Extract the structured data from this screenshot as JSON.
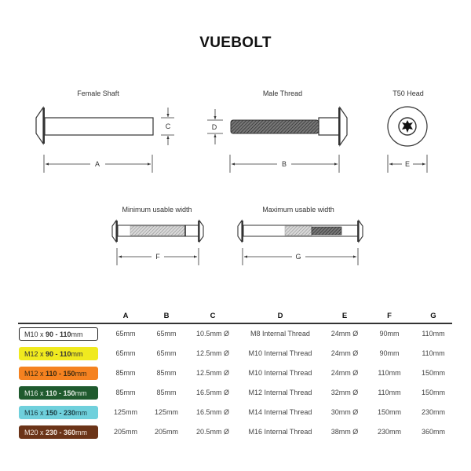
{
  "title": "VUEBOLT",
  "diagrams": {
    "female_shaft": {
      "label": "Female Shaft",
      "dims": [
        "A",
        "C"
      ]
    },
    "male_thread": {
      "label": "Male Thread",
      "dims": [
        "B",
        "D"
      ]
    },
    "head": {
      "label": "T50 Head",
      "dims": [
        "E"
      ]
    },
    "min_width": {
      "label": "Minimum usable width",
      "dims": [
        "F"
      ]
    },
    "max_width": {
      "label": "Maximum usable width",
      "dims": [
        "G"
      ]
    }
  },
  "table": {
    "columns": [
      "A",
      "B",
      "C",
      "D",
      "E",
      "F",
      "G"
    ],
    "rows": [
      {
        "size": "M10 x ",
        "range": "90 - 110",
        "unit": "mm",
        "bg": "#ffffff",
        "fg": "#333333",
        "border": "#222222",
        "values": [
          "65mm",
          "65mm",
          "10.5mm Ø",
          "M8 Internal Thread",
          "24mm Ø",
          "90mm",
          "110mm"
        ]
      },
      {
        "size": "M12 x ",
        "range": "90 - 110",
        "unit": "mm",
        "bg": "#f0ea1f",
        "fg": "#333333",
        "border": "#f0ea1f",
        "values": [
          "65mm",
          "65mm",
          "12.5mm Ø",
          "M10 Internal Thread",
          "24mm Ø",
          "90mm",
          "110mm"
        ]
      },
      {
        "size": "M12 x ",
        "range": "110 - 150",
        "unit": "mm",
        "bg": "#f58220",
        "fg": "#3a2a10",
        "border": "#f58220",
        "values": [
          "85mm",
          "85mm",
          "12.5mm Ø",
          "M10 Internal Thread",
          "24mm Ø",
          "110mm",
          "150mm"
        ]
      },
      {
        "size": "M16 x ",
        "range": "110 - 150",
        "unit": "mm",
        "bg": "#1f5a2e",
        "fg": "#e8f0e8",
        "border": "#1f5a2e",
        "values": [
          "85mm",
          "85mm",
          "16.5mm Ø",
          "M12 Internal Thread",
          "32mm Ø",
          "110mm",
          "150mm"
        ]
      },
      {
        "size": "M16 x ",
        "range": "150 - 230",
        "unit": "mm",
        "bg": "#6fd0dc",
        "fg": "#1a3a40",
        "border": "#6fd0dc",
        "values": [
          "125mm",
          "125mm",
          "16.5mm Ø",
          "M14 Internal Thread",
          "30mm Ø",
          "150mm",
          "230mm"
        ]
      },
      {
        "size": "M20 x ",
        "range": "230 - 360",
        "unit": "mm",
        "bg": "#6b3418",
        "fg": "#f3e6dc",
        "border": "#6b3418",
        "values": [
          "205mm",
          "205mm",
          "20.5mm Ø",
          "M16 Internal Thread",
          "38mm Ø",
          "230mm",
          "360mm"
        ]
      }
    ]
  }
}
